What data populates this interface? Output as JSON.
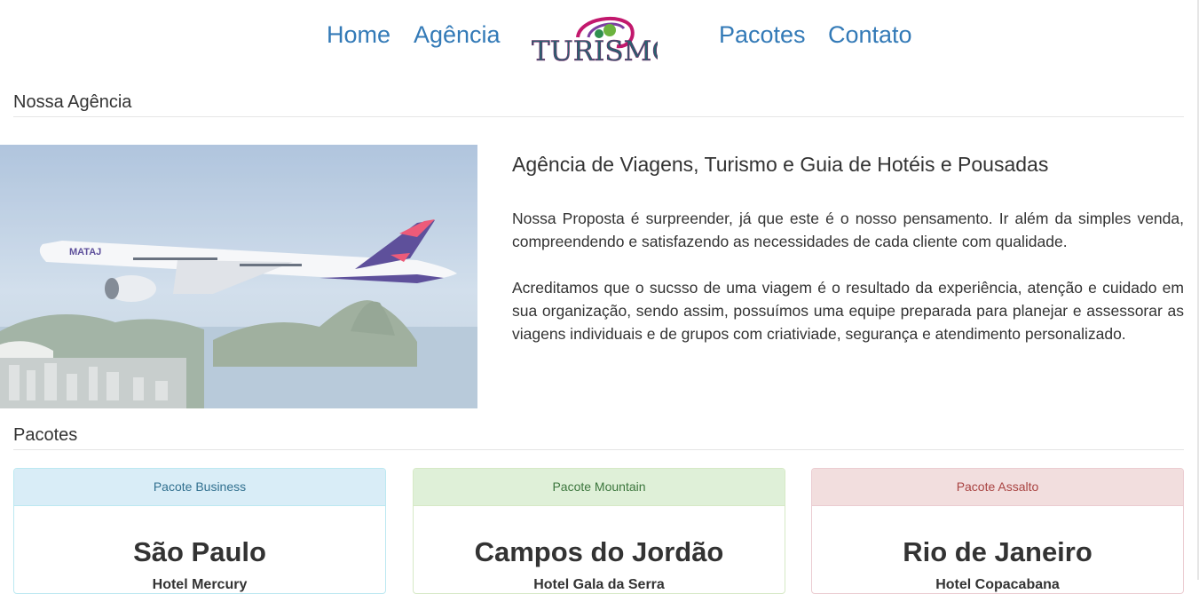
{
  "nav": {
    "items": [
      "Home",
      "Agência",
      "Pacotes",
      "Contato"
    ],
    "logo_text": "TURISMO",
    "link_color": "#337ab7"
  },
  "agency": {
    "section_title": "Nossa Agência",
    "image_label": "MATAJ",
    "title": "Agência de Viagens, Turismo e Guia de Hotéis e Pousadas",
    "paragraphs": [
      "Nossa Proposta é surpreender, já que este é o nosso pensamento. Ir além da simples venda, compreendendo e satisfazendo as necessidades de cada cliente com qualidade.",
      "Acreditamos que o sucsso de uma viagem é o resultado da experiência, atenção e cuidado em sua organização, sendo assim, possuímos uma equipe preparada para planejar e assessorar as viagens individuais e de grupos com criativiade, segurança e atendimento personalizado."
    ]
  },
  "packages": {
    "section_title": "Pacotes",
    "cards": [
      {
        "header": "Pacote Business",
        "city": "São Paulo",
        "hotel": "Hotel Mercury",
        "style": "info"
      },
      {
        "header": "Pacote Mountain",
        "city": "Campos do Jordão",
        "hotel": "Hotel Gala da Serra",
        "style": "success"
      },
      {
        "header": "Pacote Assalto",
        "city": "Rio de Janeiro",
        "hotel": "Hotel Copacabana",
        "style": "danger"
      }
    ]
  },
  "colors": {
    "info_bg": "#d9edf7",
    "info_text": "#31708f",
    "info_border": "#bce8f1",
    "success_bg": "#dff0d8",
    "success_text": "#3c763d",
    "success_border": "#d6e9c6",
    "danger_bg": "#f2dede",
    "danger_text": "#a94442",
    "danger_border": "#ebccd1"
  }
}
